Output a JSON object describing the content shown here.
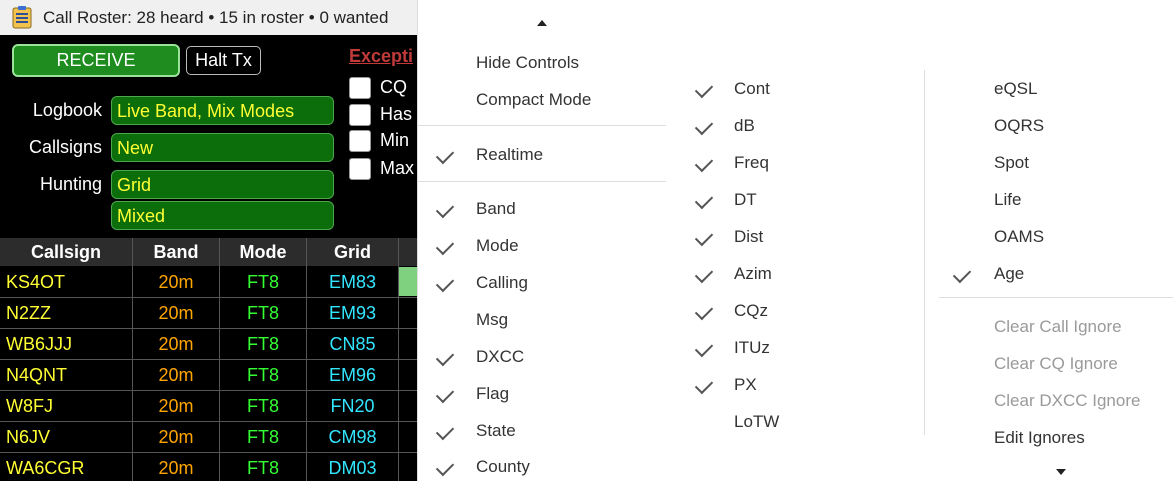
{
  "window": {
    "title": "Call Roster: 28 heard • 15 in roster • 0 wanted",
    "icon": "clipboard-list-icon"
  },
  "controls": {
    "receive_label": "RECEIVE",
    "halt_label": "Halt Tx",
    "logbook_label": "Logbook",
    "logbook_value": "Live Band, Mix Modes",
    "callsigns_label": "Callsigns",
    "callsigns_value": "New",
    "hunting_label": "Hunting",
    "hunting_value": "Grid",
    "hunting_value2": "Mixed"
  },
  "exceptions": {
    "title": "Excepti",
    "items": [
      {
        "label": "CQ"
      },
      {
        "label": "Has"
      },
      {
        "label": "Min"
      },
      {
        "label": "Max"
      }
    ]
  },
  "roster": {
    "headers": [
      "Callsign",
      "Band",
      "Mode",
      "Grid"
    ],
    "rows": [
      {
        "callsign": "KS4OT",
        "band": "20m",
        "mode": "FT8",
        "grid": "EM83"
      },
      {
        "callsign": "N2ZZ",
        "band": "20m",
        "mode": "FT8",
        "grid": "EM93"
      },
      {
        "callsign": "WB6JJJ",
        "band": "20m",
        "mode": "FT8",
        "grid": "CN85"
      },
      {
        "callsign": "N4QNT",
        "band": "20m",
        "mode": "FT8",
        "grid": "EM96"
      },
      {
        "callsign": "W8FJ",
        "band": "20m",
        "mode": "FT8",
        "grid": "FN20"
      },
      {
        "callsign": "N6JV",
        "band": "20m",
        "mode": "FT8",
        "grid": "CM98"
      },
      {
        "callsign": "WA6CGR",
        "band": "20m",
        "mode": "FT8",
        "grid": "DM03"
      }
    ]
  },
  "menu1": {
    "scroll_up_icon": "caret-up-icon",
    "items": [
      {
        "label": "Hide Controls",
        "checked": false
      },
      {
        "label": "Compact Mode",
        "checked": false
      },
      {
        "label": "Realtime",
        "checked": true
      },
      {
        "label": "Band",
        "checked": true
      },
      {
        "label": "Mode",
        "checked": true
      },
      {
        "label": "Calling",
        "checked": true
      },
      {
        "label": "Msg",
        "checked": false
      },
      {
        "label": "DXCC",
        "checked": true
      },
      {
        "label": "Flag",
        "checked": true
      },
      {
        "label": "State",
        "checked": true
      },
      {
        "label": "County",
        "checked": true
      }
    ]
  },
  "menu2": {
    "items": [
      {
        "label": "Cont",
        "checked": true
      },
      {
        "label": "dB",
        "checked": true
      },
      {
        "label": "Freq",
        "checked": true
      },
      {
        "label": "DT",
        "checked": true
      },
      {
        "label": "Dist",
        "checked": true
      },
      {
        "label": "Azim",
        "checked": true
      },
      {
        "label": "CQz",
        "checked": true
      },
      {
        "label": "ITUz",
        "checked": true
      },
      {
        "label": "PX",
        "checked": true
      },
      {
        "label": "LoTW",
        "checked": false
      }
    ]
  },
  "menu3": {
    "items": [
      {
        "label": "eQSL",
        "checked": false
      },
      {
        "label": "OQRS",
        "checked": false
      },
      {
        "label": "Spot",
        "checked": false
      },
      {
        "label": "Life",
        "checked": false
      },
      {
        "label": "OAMS",
        "checked": false
      },
      {
        "label": "Age",
        "checked": true
      }
    ],
    "actions": [
      {
        "label": "Clear Call Ignore",
        "disabled": true
      },
      {
        "label": "Clear CQ Ignore",
        "disabled": true
      },
      {
        "label": "Clear DXCC Ignore",
        "disabled": true
      },
      {
        "label": "Edit Ignores",
        "disabled": false
      }
    ],
    "scroll_down_icon": "caret-down-icon"
  },
  "colors": {
    "callsign": "#ffff33",
    "band": "#ffa500",
    "mode": "#33ff33",
    "grid": "#33e6ff"
  }
}
